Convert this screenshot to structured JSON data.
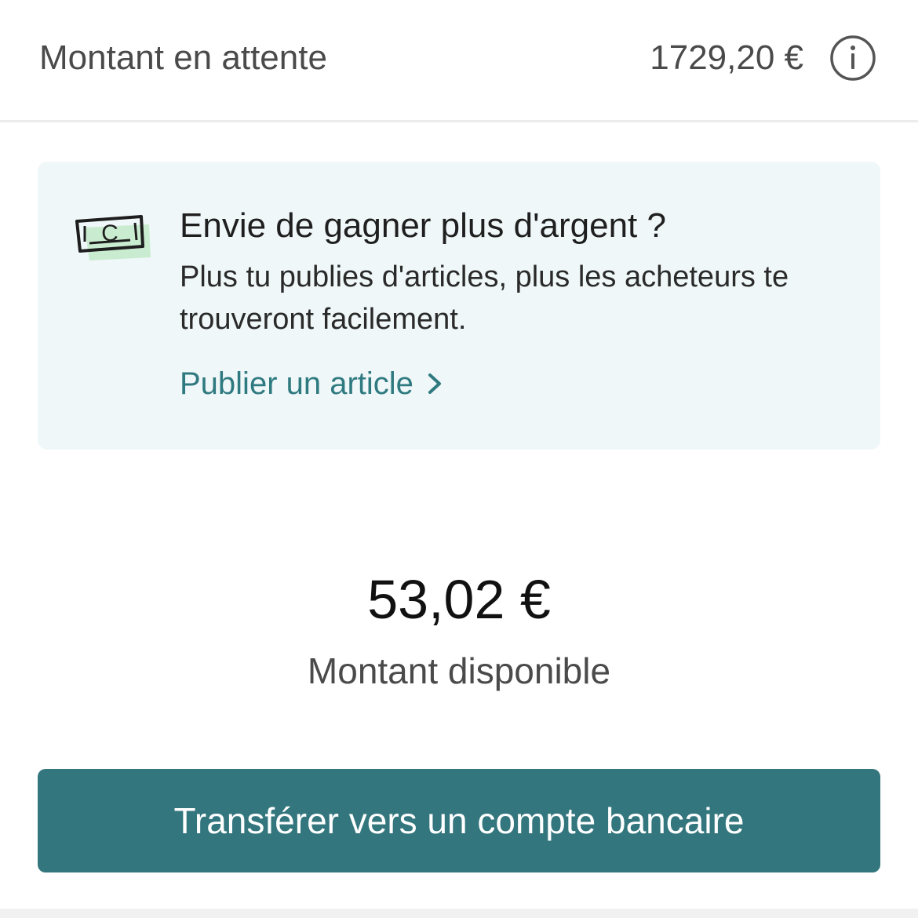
{
  "pending": {
    "label": "Montant en attente",
    "amount": "1729,20 €",
    "info_icon": "info-circle-icon"
  },
  "promo": {
    "icon": "banknote-icon",
    "icon_letter": "C",
    "title": "Envie de gagner plus d'argent ?",
    "body": "Plus tu publies d'articles, plus les acheteurs te trouveront facilement.",
    "link_label": "Publier un article",
    "link_icon": "chevron-right-icon"
  },
  "balance": {
    "amount": "53,02 €",
    "label": "Montant disponible"
  },
  "transfer": {
    "button_label": "Transférer vers un compte bancaire"
  },
  "colors": {
    "accent": "#33767e",
    "link": "#2f7a80",
    "card_background": "#eff7f8",
    "banknote_green": "#c9ecd0"
  }
}
